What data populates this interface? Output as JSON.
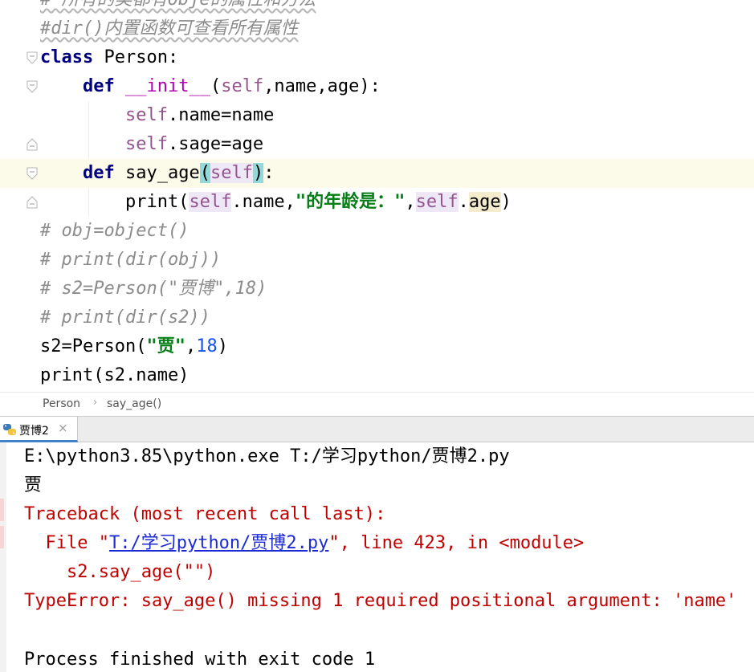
{
  "editor": {
    "lines": [
      {
        "segments": [
          {
            "t": "# 所有的类都有obje的属性和方法",
            "c": "cm"
          }
        ]
      },
      {
        "segments": [
          {
            "t": "#dir()内置函数可查看所有属性",
            "c": "cm"
          }
        ]
      },
      {
        "segments": [
          {
            "t": "class",
            "c": "kw"
          },
          {
            "t": " Person:",
            "c": ""
          }
        ]
      },
      {
        "segments": [
          {
            "t": "    ",
            "c": ""
          },
          {
            "t": "def",
            "c": "kw"
          },
          {
            "t": " ",
            "c": ""
          },
          {
            "t": "__init__",
            "c": "dunder"
          },
          {
            "t": "(",
            "c": ""
          },
          {
            "t": "self",
            "c": "slf"
          },
          {
            "t": ",name,age):",
            "c": ""
          }
        ]
      },
      {
        "segments": [
          {
            "t": "        ",
            "c": ""
          },
          {
            "t": "self",
            "c": "slf"
          },
          {
            "t": ".name=name",
            "c": ""
          }
        ]
      },
      {
        "segments": [
          {
            "t": "        ",
            "c": ""
          },
          {
            "t": "self",
            "c": "slf"
          },
          {
            "t": ".sage=age",
            "c": ""
          }
        ]
      },
      {
        "segments": [
          {
            "t": "    ",
            "c": ""
          },
          {
            "t": "def",
            "c": "kw"
          },
          {
            "t": " say_age",
            "c": ""
          },
          {
            "t": "(",
            "c": "brace-hl"
          },
          {
            "t": "self",
            "c": "slf param-hl"
          },
          {
            "t": ")",
            "c": "brace-hl"
          },
          {
            "t": ":",
            "c": ""
          }
        ]
      },
      {
        "segments": [
          {
            "t": "        print(",
            "c": ""
          },
          {
            "t": "self",
            "c": "slf param-hl"
          },
          {
            "t": ".name,",
            "c": ""
          },
          {
            "t": "\"的年龄是：\"",
            "c": "str"
          },
          {
            "t": ",",
            "c": ""
          },
          {
            "t": "self",
            "c": "slf param-hl"
          },
          {
            "t": ".",
            "c": ""
          },
          {
            "t": "age",
            "c": "age-hl"
          },
          {
            "t": ")",
            "c": ""
          }
        ]
      },
      {
        "segments": [
          {
            "t": "# obj=object()",
            "c": "cm"
          }
        ]
      },
      {
        "segments": [
          {
            "t": "# print(dir(obj))",
            "c": "cm"
          }
        ]
      },
      {
        "segments": [
          {
            "t": "# s2=Person(\"贾博\",18)",
            "c": "cm"
          }
        ]
      },
      {
        "segments": [
          {
            "t": "# print(dir(s2))",
            "c": "cm"
          }
        ]
      },
      {
        "segments": [
          {
            "t": "s2=Person(",
            "c": ""
          },
          {
            "t": "\"贾\"",
            "c": "str"
          },
          {
            "t": ",",
            "c": ""
          },
          {
            "t": "18",
            "c": "num"
          },
          {
            "t": ")",
            "c": ""
          }
        ]
      },
      {
        "segments": [
          {
            "t": "print(s2.name)",
            "c": ""
          }
        ]
      }
    ]
  },
  "breadcrumb": {
    "items": [
      "Person",
      "say_age()"
    ],
    "separator": "›"
  },
  "run_panel": {
    "tab_label": "贾博2",
    "tab_icon": "python-icon",
    "close_glyph": "×"
  },
  "console": {
    "command": "E:\\python3.85\\python.exe T:/学习python/贾博2.py",
    "output": "贾",
    "traceback_header": "Traceback (most recent call last):",
    "file_prefix": "  File \"",
    "file_link": "T:/学习python/贾博2.py",
    "file_suffix": "\", line 423, in <module>",
    "source_line": "    s2.say_age(\"\")",
    "error": "TypeError: say_age() missing 1 required positional argument: 'name'",
    "exit_message": "Process finished with exit code 1"
  },
  "colors": {
    "keyword": "#000080",
    "self": "#94558d",
    "string": "#067d17",
    "number": "#1750eb",
    "comment": "#8c8c8c",
    "error": "#c00000",
    "link": "#1c2ad6",
    "current_line": "#fcfae8"
  }
}
